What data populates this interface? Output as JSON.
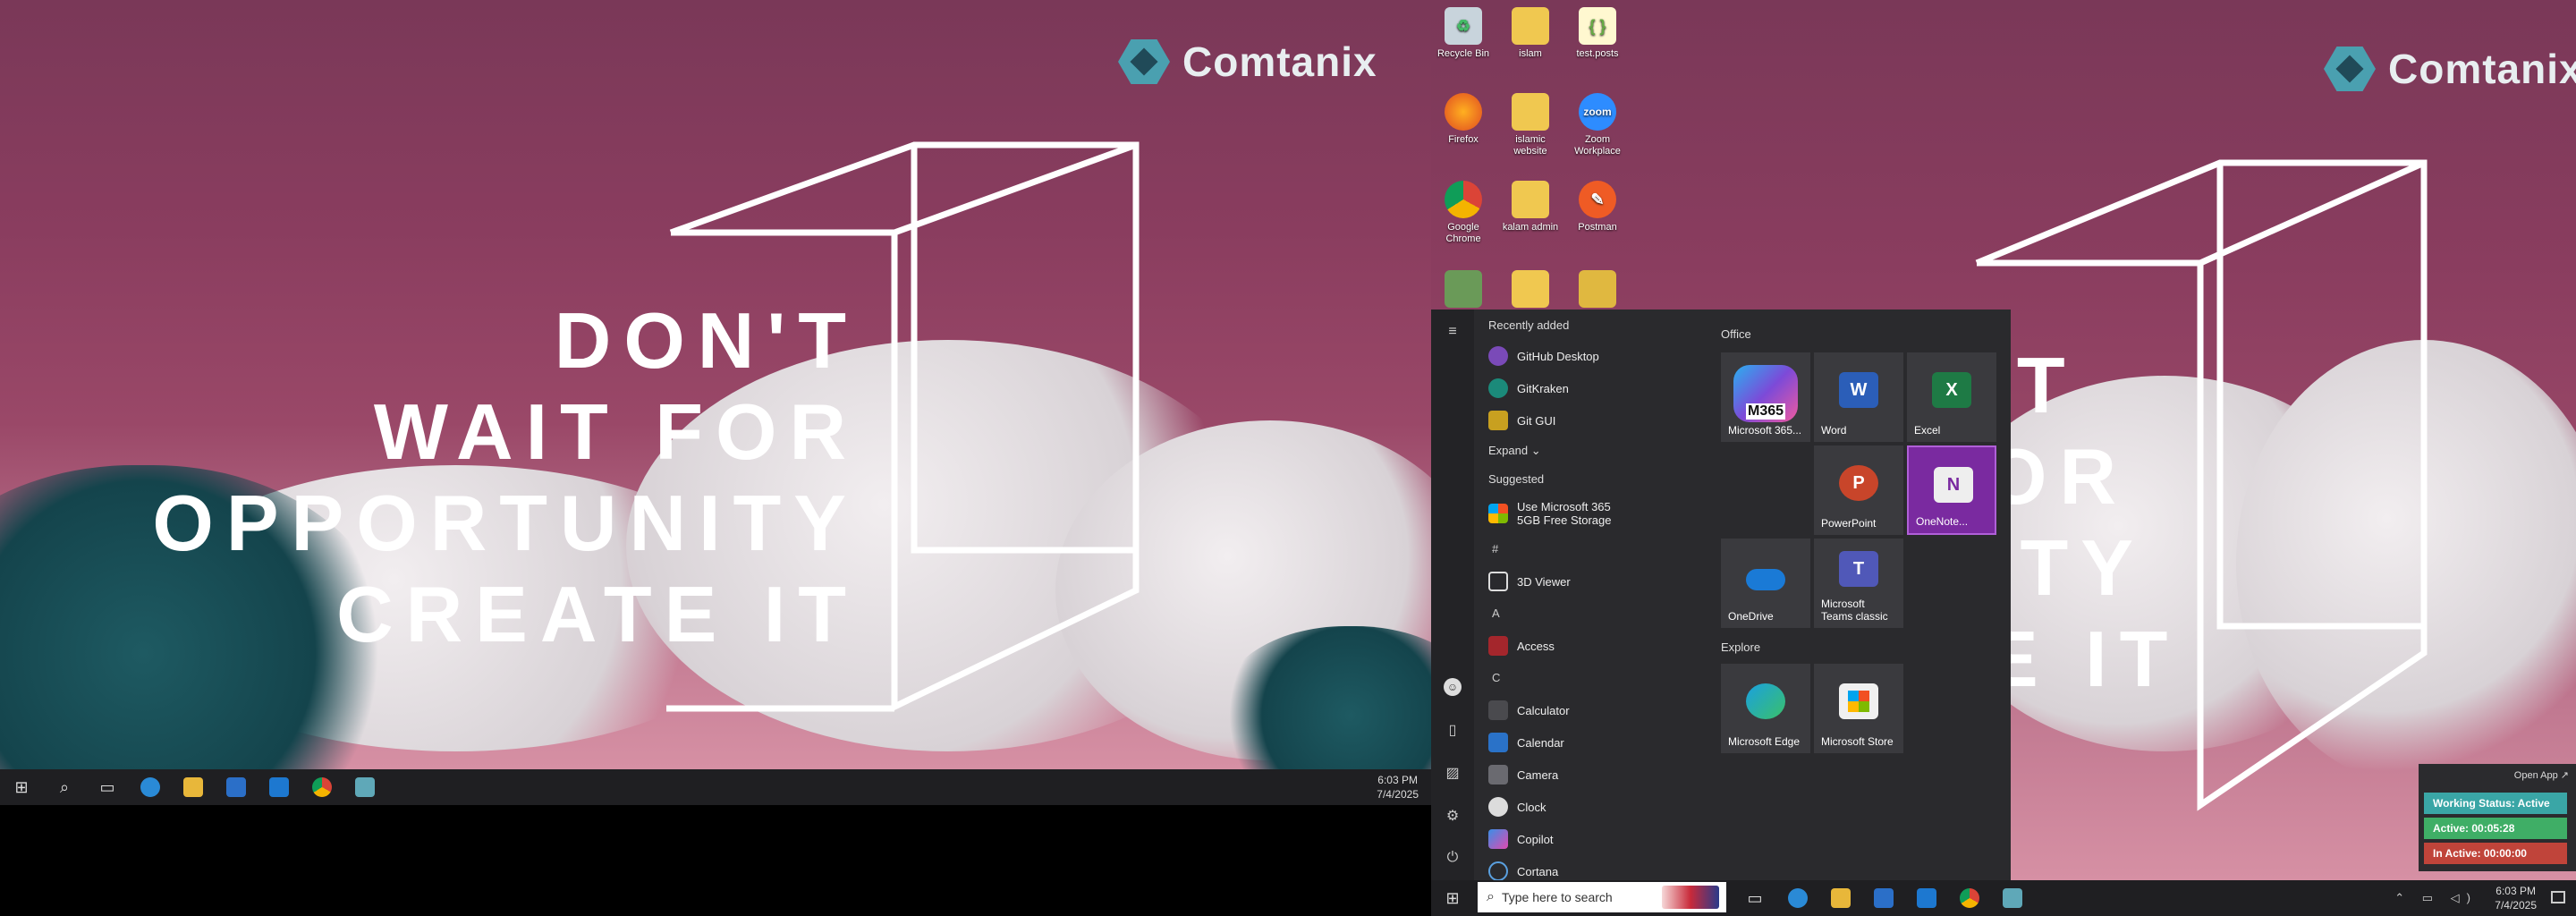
{
  "brand": "Comtanix",
  "quote": {
    "line1": "DON'T",
    "line2": "WAIT FOR",
    "line3": "OPPORTUNITY",
    "line4": "CREATE IT"
  },
  "quote2": {
    "line1": "'T",
    "line2": "OR",
    "line3": "ITY",
    "line4": "E IT"
  },
  "desktop_icons": {
    "recycle": "Recycle Bin",
    "islam": "islam",
    "testposts": "test.posts",
    "firefox": "Firefox",
    "islamic": "islamic website",
    "zoom": "Zoom Workplace",
    "zoom_logo": "zoom",
    "chrome": "Google Chrome",
    "kalam": "kalam admin",
    "postman": "Postman"
  },
  "start_menu": {
    "recently_added": "Recently added",
    "recent": [
      "GitHub Desktop",
      "GitKraken",
      "Git GUI"
    ],
    "expand": "Expand",
    "suggested": "Suggested",
    "suggested_item": "Use Microsoft 365",
    "suggested_sub": "5GB Free Storage",
    "letter_hash": "#",
    "viewer": "3D Viewer",
    "letter_a": "A",
    "access": "Access",
    "letter_c": "C",
    "c_apps": [
      "Calculator",
      "Calendar",
      "Camera",
      "Clock",
      "Copilot",
      "Cortana"
    ],
    "group_office": "Office",
    "group_explore": "Explore",
    "tiles": {
      "m365": "Microsoft 365...",
      "m365_badge": "M365",
      "word": "Word",
      "excel": "Excel",
      "powerpoint": "PowerPoint",
      "onenote": "OneNote...",
      "onedrive": "OneDrive",
      "teams": "Microsoft Teams classic",
      "edge": "Microsoft Edge",
      "store": "Microsoft Store"
    }
  },
  "search_placeholder": "Type here to search",
  "clock": {
    "time": "6:03 PM",
    "date": "7/4/2025"
  },
  "widget": {
    "open_app": "Open App ↗",
    "status": "Working Status: Active",
    "active": "Active: 00:05:28",
    "inactive": "In Active: 00:00:00"
  },
  "colors": {
    "status_green": "#3fae66",
    "status_teal": "#3aa6a6",
    "status_red": "#c0443a",
    "start_bg": "#2a2a2d"
  }
}
